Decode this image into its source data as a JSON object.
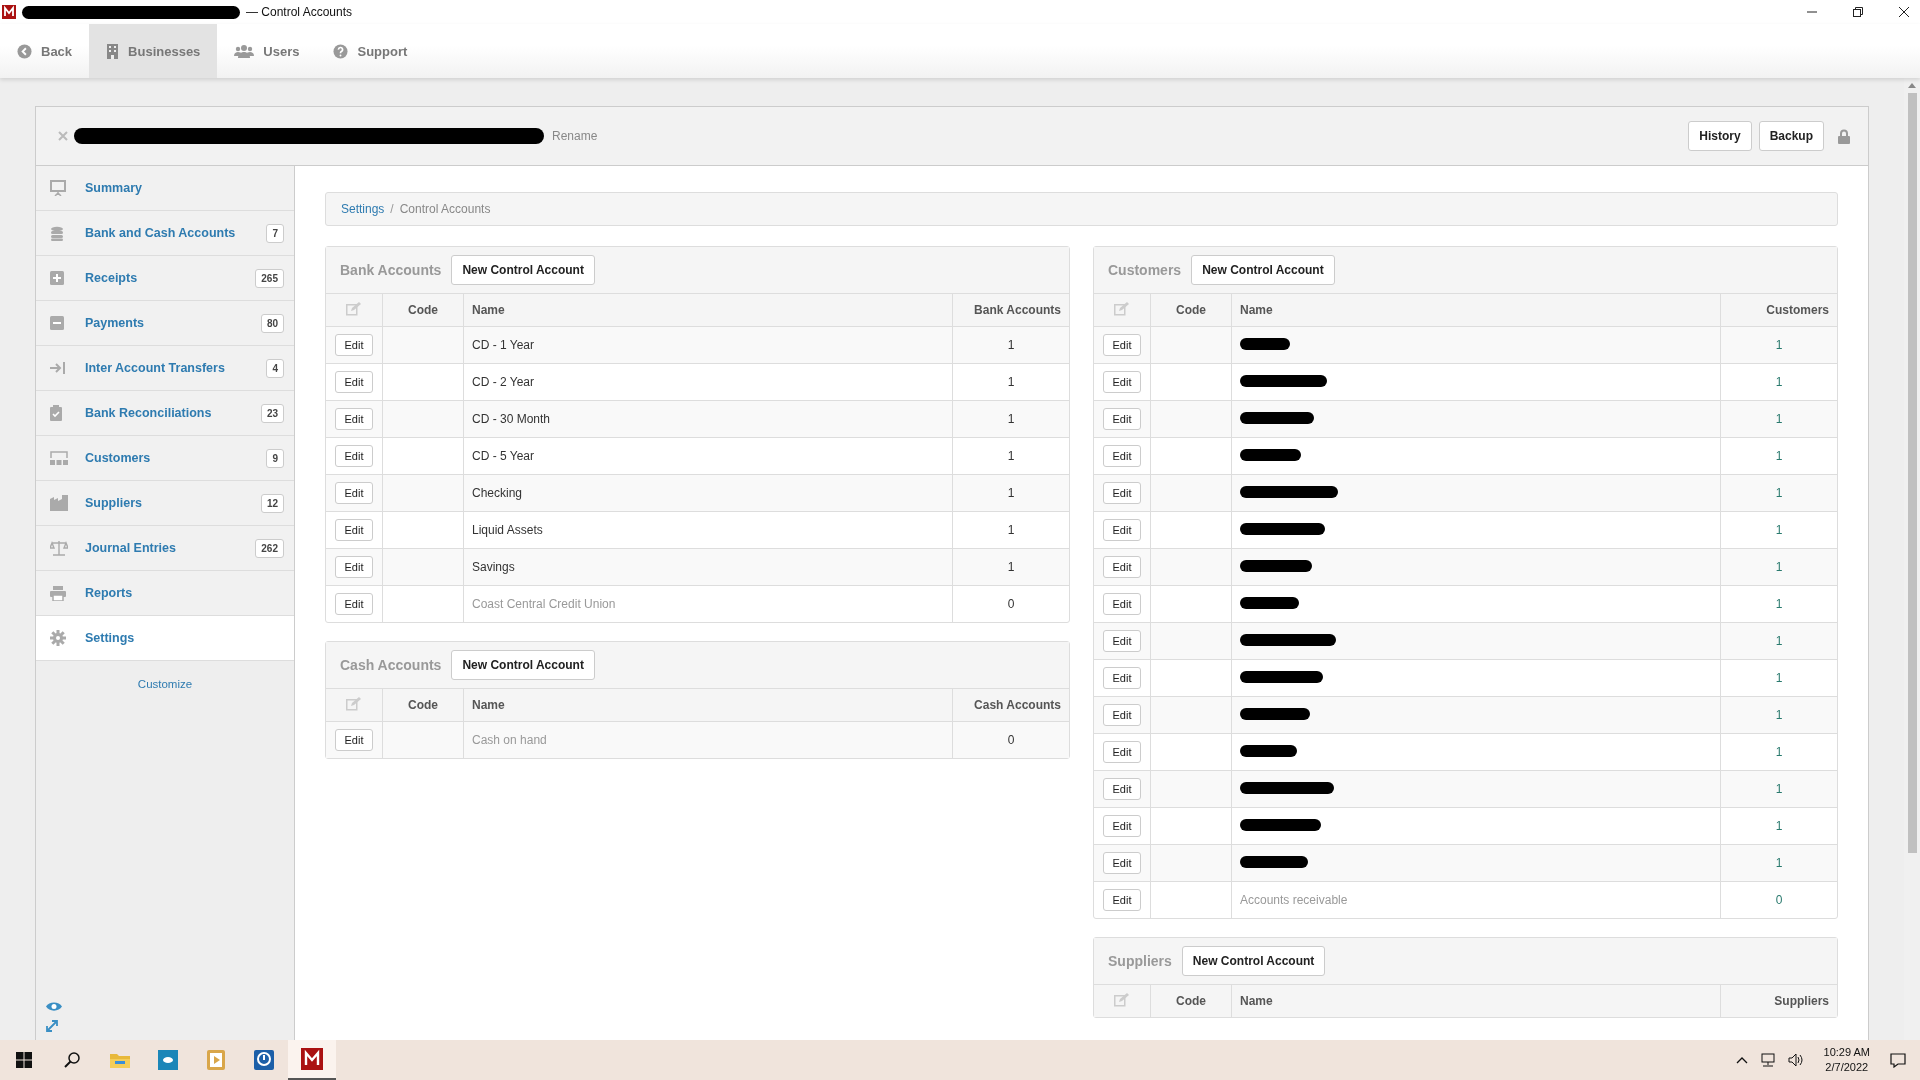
{
  "window": {
    "title": "— Control Accounts",
    "title_redacted": true
  },
  "nav": [
    {
      "label": "Back",
      "selected": false
    },
    {
      "label": "Businesses",
      "selected": true
    },
    {
      "label": "Users",
      "selected": false
    },
    {
      "label": "Support",
      "selected": false
    }
  ],
  "business": {
    "name_redacted": true,
    "rename": "Rename",
    "buttons": [
      "History",
      "Backup"
    ]
  },
  "sidebar": {
    "items": [
      {
        "label": "Summary",
        "selected": false
      },
      {
        "label": "Bank and Cash Accounts",
        "count": "7",
        "selected": false
      },
      {
        "label": "Receipts",
        "count": "265",
        "selected": false
      },
      {
        "label": "Payments",
        "count": "80",
        "selected": false
      },
      {
        "label": "Inter Account Transfers",
        "count": "4",
        "selected": false
      },
      {
        "label": "Bank Reconciliations",
        "count": "23",
        "selected": false
      },
      {
        "label": "Customers",
        "count": "9",
        "selected": false
      },
      {
        "label": "Suppliers",
        "count": "12",
        "selected": false
      },
      {
        "label": "Journal Entries",
        "count": "262",
        "selected": false
      },
      {
        "label": "Reports",
        "selected": false
      },
      {
        "label": "Settings",
        "selected": true
      }
    ],
    "customize": "Customize"
  },
  "breadcrumb": {
    "items": [
      "Settings",
      "Control Accounts"
    ],
    "separator": "/"
  },
  "left_sections": [
    {
      "title": "Bank Accounts",
      "button": "New Control Account",
      "columns": [
        "Code",
        "Name",
        "Bank Accounts"
      ],
      "count_link": false,
      "rows": [
        {
          "edit": "Edit",
          "name": "CD - 1 Year",
          "count": "1",
          "inactive": false
        },
        {
          "edit": "Edit",
          "name": "CD - 2 Year",
          "count": "1",
          "inactive": false
        },
        {
          "edit": "Edit",
          "name": "CD - 30 Month",
          "count": "1",
          "inactive": false
        },
        {
          "edit": "Edit",
          "name": "CD - 5 Year",
          "count": "1",
          "inactive": false
        },
        {
          "edit": "Edit",
          "name": "Checking",
          "count": "1",
          "inactive": false
        },
        {
          "edit": "Edit",
          "name": "Liquid Assets",
          "count": "1",
          "inactive": false
        },
        {
          "edit": "Edit",
          "name": "Savings",
          "count": "1",
          "inactive": false
        },
        {
          "edit": "Edit",
          "name": "Coast Central Credit Union",
          "count": "0",
          "inactive": true
        }
      ]
    },
    {
      "title": "Cash Accounts",
      "button": "New Control Account",
      "columns": [
        "Code",
        "Name",
        "Cash Accounts"
      ],
      "count_link": false,
      "rows": [
        {
          "edit": "Edit",
          "name": "Cash on hand",
          "count": "0",
          "inactive": true
        }
      ]
    }
  ],
  "right_sections": [
    {
      "title": "Customers",
      "button": "New Control Account",
      "columns": [
        "Code",
        "Name",
        "Customers"
      ],
      "count_link": true,
      "rows": [
        {
          "edit": "Edit",
          "redacted": true,
          "count": "1"
        },
        {
          "edit": "Edit",
          "redacted": true,
          "count": "1"
        },
        {
          "edit": "Edit",
          "redacted": true,
          "count": "1"
        },
        {
          "edit": "Edit",
          "redacted": true,
          "count": "1"
        },
        {
          "edit": "Edit",
          "redacted": true,
          "count": "1"
        },
        {
          "edit": "Edit",
          "redacted": true,
          "count": "1"
        },
        {
          "edit": "Edit",
          "redacted": true,
          "count": "1"
        },
        {
          "edit": "Edit",
          "redacted": true,
          "count": "1"
        },
        {
          "edit": "Edit",
          "redacted": true,
          "count": "1"
        },
        {
          "edit": "Edit",
          "redacted": true,
          "count": "1"
        },
        {
          "edit": "Edit",
          "redacted": true,
          "count": "1"
        },
        {
          "edit": "Edit",
          "redacted": true,
          "count": "1"
        },
        {
          "edit": "Edit",
          "redacted": true,
          "count": "1"
        },
        {
          "edit": "Edit",
          "redacted": true,
          "count": "1"
        },
        {
          "edit": "Edit",
          "redacted": true,
          "count": "1"
        },
        {
          "edit": "Edit",
          "name": "Accounts receivable",
          "count": "0",
          "inactive": true
        }
      ]
    },
    {
      "title": "Suppliers",
      "button": "New Control Account",
      "columns": [
        "Code",
        "Name",
        "Suppliers"
      ]
    }
  ],
  "taskbar": {
    "apps": [
      {
        "kind": "start",
        "selected": false
      },
      {
        "kind": "search",
        "selected": false
      },
      {
        "kind": "folder",
        "selected": false
      },
      {
        "kind": "app",
        "selected": false
      },
      {
        "kind": "media",
        "selected": false
      },
      {
        "kind": "remote",
        "selected": false
      },
      {
        "kind": "manager",
        "selected": true
      }
    ],
    "time": "10:29 AM",
    "date": "2/7/2022"
  }
}
